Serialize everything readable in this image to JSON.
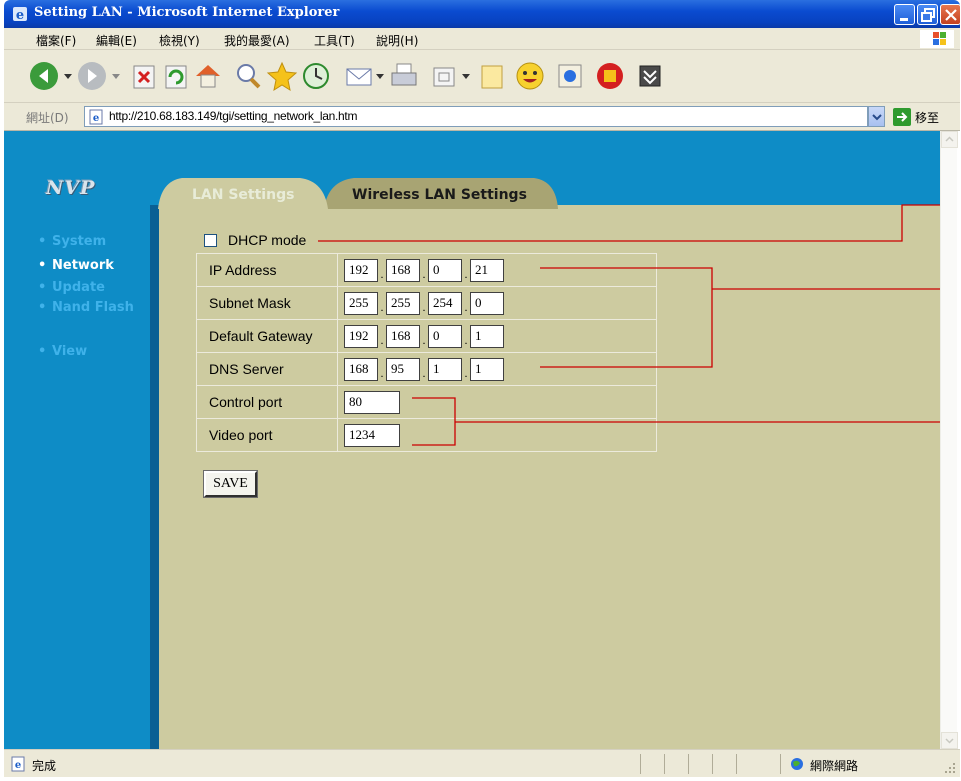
{
  "window": {
    "title": "Setting LAN - Microsoft Internet Explorer"
  },
  "menu": {
    "items": [
      "檔案(F)",
      "編輯(E)",
      "檢視(Y)",
      "我的最愛(A)",
      "工具(T)",
      "說明(H)"
    ]
  },
  "toolbar": {
    "icons": [
      "back-icon",
      "forward-icon",
      "stop-icon",
      "refresh-icon",
      "home-icon",
      "search-icon",
      "favorites-icon",
      "history-icon",
      "mail-icon",
      "print-icon",
      "edit-icon",
      "discuss-icon",
      "messenger-icon",
      "media-icon",
      "research-icon",
      "extra-icon"
    ]
  },
  "address": {
    "label": "網址(D)",
    "url": "http://210.68.183.149/tgi/setting_network_lan.htm",
    "go_label": "移至"
  },
  "app": {
    "logo": "NVP"
  },
  "sidebar": {
    "items": [
      {
        "label": "System",
        "active": false
      },
      {
        "label": "Network",
        "active": true
      },
      {
        "label": "Update",
        "active": false
      },
      {
        "label": "Nand Flash",
        "active": false
      },
      {
        "label": "View",
        "active": false
      }
    ]
  },
  "tabs": {
    "lan": "LAN Settings",
    "wireless": "Wireless LAN Settings"
  },
  "form": {
    "dhcp_label": "DHCP mode",
    "dhcp_checked": false,
    "ip_address": {
      "label": "IP Address",
      "octets": [
        "192",
        "168",
        "0",
        "21"
      ]
    },
    "subnet_mask": {
      "label": "Subnet Mask",
      "octets": [
        "255",
        "255",
        "254",
        "0"
      ]
    },
    "default_gateway": {
      "label": "Default Gateway",
      "octets": [
        "192",
        "168",
        "0",
        "1"
      ]
    },
    "dns_server": {
      "label": "DNS Server",
      "octets": [
        "168",
        "95",
        "1",
        "1"
      ]
    },
    "control_port": {
      "label": "Control port",
      "value": "80"
    },
    "video_port": {
      "label": "Video port",
      "value": "1234"
    },
    "save_label": "SAVE"
  },
  "status": {
    "text": "完成",
    "zone": "網際網路"
  },
  "colors": {
    "page_blue": "#0e8cc6",
    "panel_beige": "#cdcba0",
    "annotation_red": "#cc0000"
  }
}
